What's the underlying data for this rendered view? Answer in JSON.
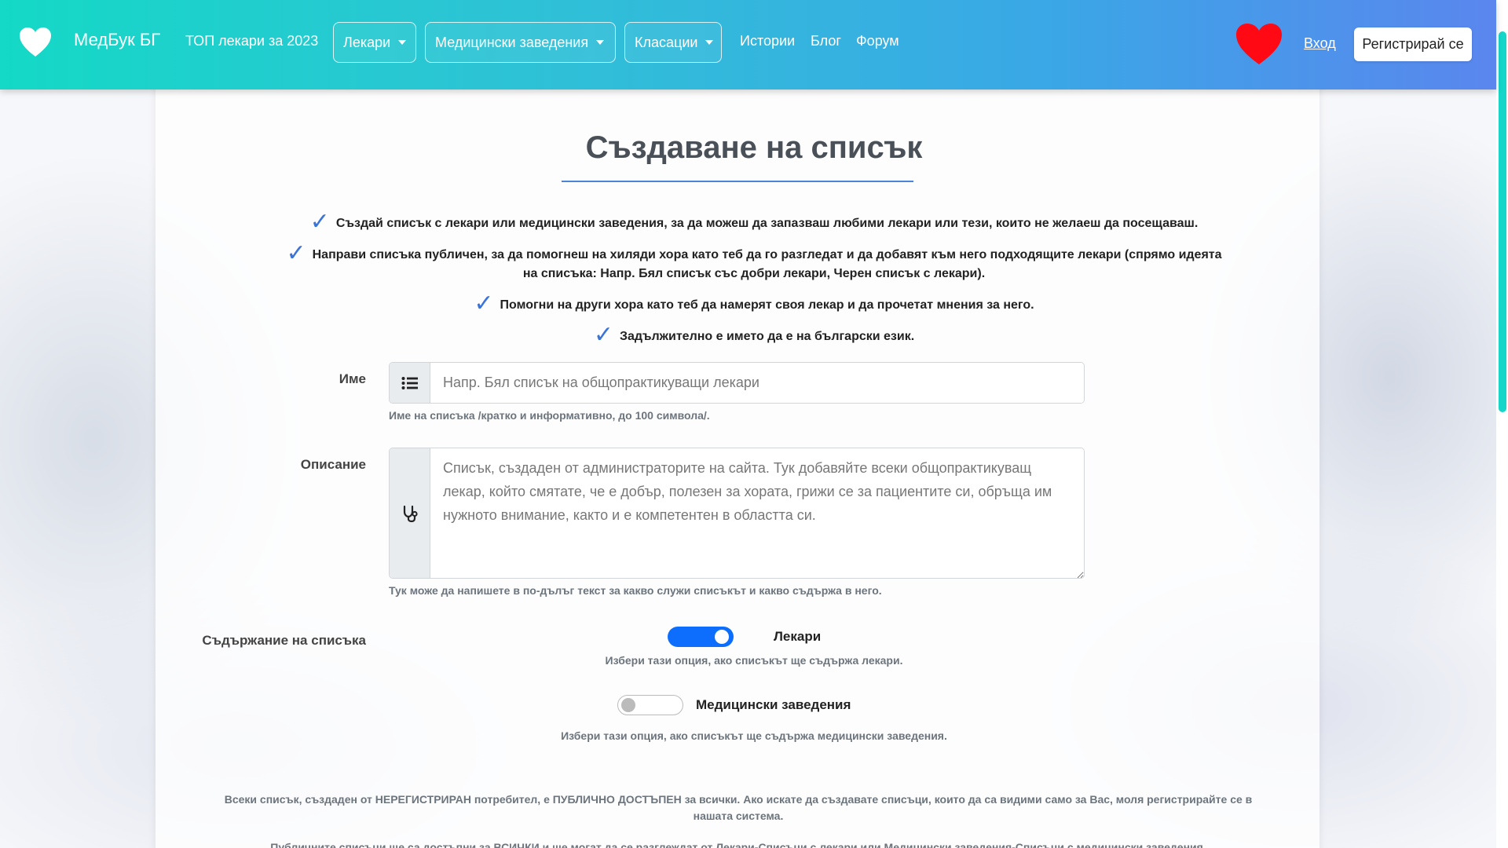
{
  "navbar": {
    "brand": "МедБук БГ",
    "top_doctors": "ТОП лекари за 2023",
    "dropdowns": [
      {
        "label": "Лекари"
      },
      {
        "label": "Медицински заведения"
      },
      {
        "label": "Класации"
      }
    ],
    "links": [
      {
        "label": "Истории"
      },
      {
        "label": "Блог"
      },
      {
        "label": "Форум"
      }
    ],
    "login": "Вход",
    "register": "Регистрирай се"
  },
  "page": {
    "title": "Създаване на списък",
    "bullets": [
      "Създай списък с лекари или медицински заведения, за да можеш да запазваш любими лекари или тези, които не желаеш да посещаваш.",
      "Направи списъка публичен, за да помогнеш на хиляди хора като теб да го разгледат и да добавят към него подходящите лекари (спрямо идеята",
      "на списъка: Напр. Бял списък със добри лекари, Черен списък с лекари).",
      "Помогни на други хора като теб да намерят своя лекар и да прочетат мнения за него.",
      "Задължително е името да е на български език."
    ]
  },
  "form": {
    "name_label": "Име",
    "name_placeholder": "Напр. Бял списък на общопрактикуващи лекари",
    "name_help": "Име на списъка /кратко и информативно, до 100 символа/.",
    "desc_label": "Описание",
    "desc_placeholder": "Списък, създаден от администраторите на сайта. Тук добавяйте всеки общопрактикуващ лекар, който смятате, че е добър, полезен за хората, грижи се за пациентите си, обръща им нужното внимание, както и е компетентен в областта си.",
    "desc_help": "Тук може да напишете в по-дълъг текст за какво служи списъкът и какво съдържа в него.",
    "content_label": "Съдържание на списъка",
    "toggle_doctors": {
      "label": "Лекари",
      "help": "Избери тази опция, ако списъкът ще съдържа лекари.",
      "checked": true
    },
    "toggle_facilities": {
      "label": "Медицински заведения",
      "help": "Избери тази опция, ако списъкът ще съдържа медицински заведения.",
      "checked": false
    }
  },
  "notes": {
    "note1": "Всеки списък, създаден от НЕРЕГИСТРИРАН потребител, е ПУБЛИЧНО ДОСТЪПЕН за всички. Ако искате да създавате списъци, които да са видими само за Вас, моля регистрирайте се в нашата система.",
    "note2": "Публичните списъци ще са достъпни за ВСИЧКИ и ще могат да се разглеждат от Лекари-Списъци с лекари или Медицински заведения-Списъци с медицински заведения."
  },
  "colors": {
    "accent": "#0d6efd",
    "check": "#3b74d8",
    "heart": "#ff0a14"
  }
}
